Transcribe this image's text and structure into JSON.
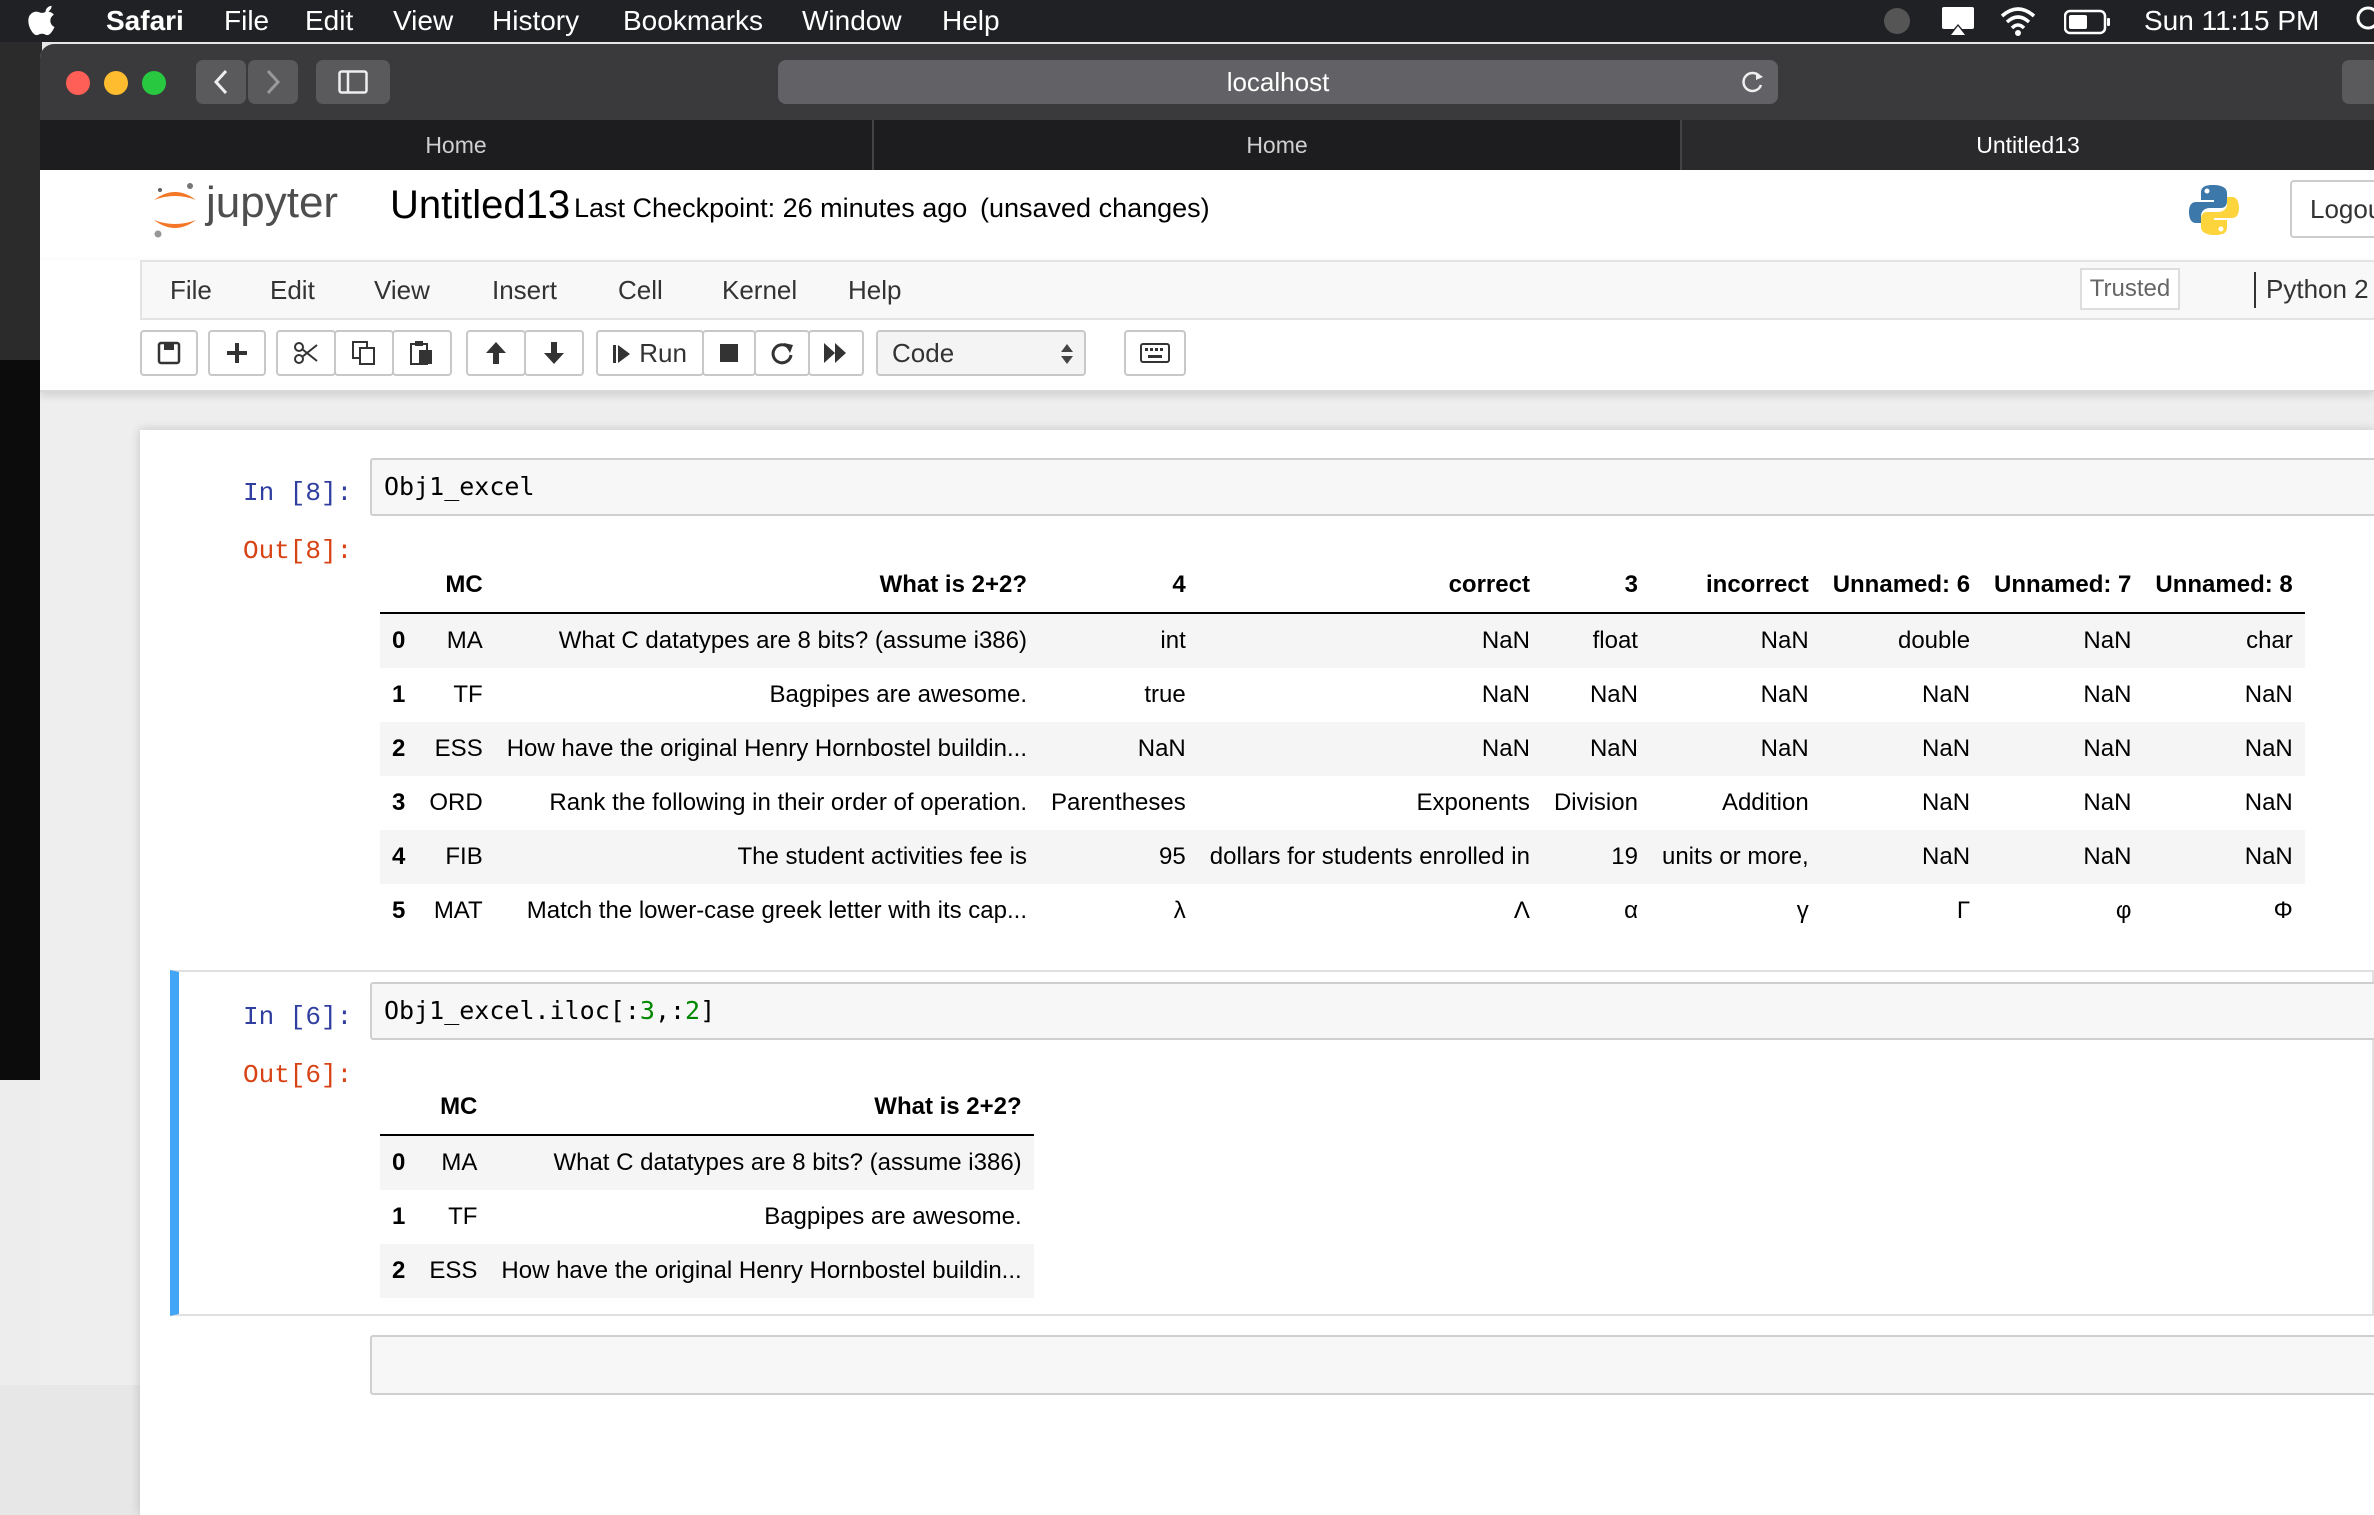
{
  "menubar": {
    "apple": "",
    "items": [
      "Safari",
      "File",
      "Edit",
      "View",
      "History",
      "Bookmarks",
      "Window",
      "Help"
    ],
    "clock": "Sun 11:15 PM"
  },
  "safari": {
    "url": "localhost",
    "tabs": [
      "Home",
      "Home",
      "Untitled13"
    ]
  },
  "jupyter": {
    "logo_text": "jupyter",
    "notebook_name": "Untitled13",
    "checkpoint": "Last Checkpoint: 26 minutes ago",
    "unsaved": "(unsaved changes)",
    "logout": "Logout",
    "menu": [
      "File",
      "Edit",
      "View",
      "Insert",
      "Cell",
      "Kernel",
      "Help"
    ],
    "trusted": "Trusted",
    "kernel": "Python 2",
    "run_label": "Run",
    "cell_type": "Code"
  },
  "cells": {
    "c1": {
      "in_prompt": "In [8]:",
      "code": "Obj1_excel",
      "out_prompt": "Out[8]:",
      "columns": [
        "",
        "MC",
        "What is 2+2?",
        "4",
        "correct",
        "3",
        "incorrect",
        "Unnamed: 6",
        "Unnamed: 7",
        "Unnamed: 8"
      ],
      "rows": [
        [
          "0",
          "MA",
          "What C datatypes are 8 bits? (assume i386)",
          "int",
          "NaN",
          "float",
          "NaN",
          "double",
          "NaN",
          "char"
        ],
        [
          "1",
          "TF",
          "Bagpipes are awesome.",
          "true",
          "NaN",
          "NaN",
          "NaN",
          "NaN",
          "NaN",
          "NaN"
        ],
        [
          "2",
          "ESS",
          "How have the original Henry Hornbostel buildin...",
          "NaN",
          "NaN",
          "NaN",
          "NaN",
          "NaN",
          "NaN",
          "NaN"
        ],
        [
          "3",
          "ORD",
          "Rank the following in their order of operation.",
          "Parentheses",
          "Exponents",
          "Division",
          "Addition",
          "NaN",
          "NaN",
          "NaN"
        ],
        [
          "4",
          "FIB",
          "The student activities fee is",
          "95",
          "dollars for students enrolled in",
          "19",
          "units or more,",
          "NaN",
          "NaN",
          "NaN"
        ],
        [
          "5",
          "MAT",
          "Match the lower-case greek letter with its cap...",
          "λ",
          "Λ",
          "α",
          "γ",
          "Γ",
          "φ",
          "Φ"
        ]
      ]
    },
    "c2": {
      "in_prompt": "In [6]:",
      "code_prefix": "Obj1_excel.iloc[:",
      "code_num1": "3",
      "code_mid": ",:",
      "code_num2": "2",
      "code_suffix": "]",
      "out_prompt": "Out[6]:",
      "columns": [
        "",
        "MC",
        "What is 2+2?"
      ],
      "rows": [
        [
          "0",
          "MA",
          "What C datatypes are 8 bits? (assume i386)"
        ],
        [
          "1",
          "TF",
          "Bagpipes are awesome."
        ],
        [
          "2",
          "ESS",
          "How have the original Henry Hornbostel buildin..."
        ]
      ]
    }
  }
}
